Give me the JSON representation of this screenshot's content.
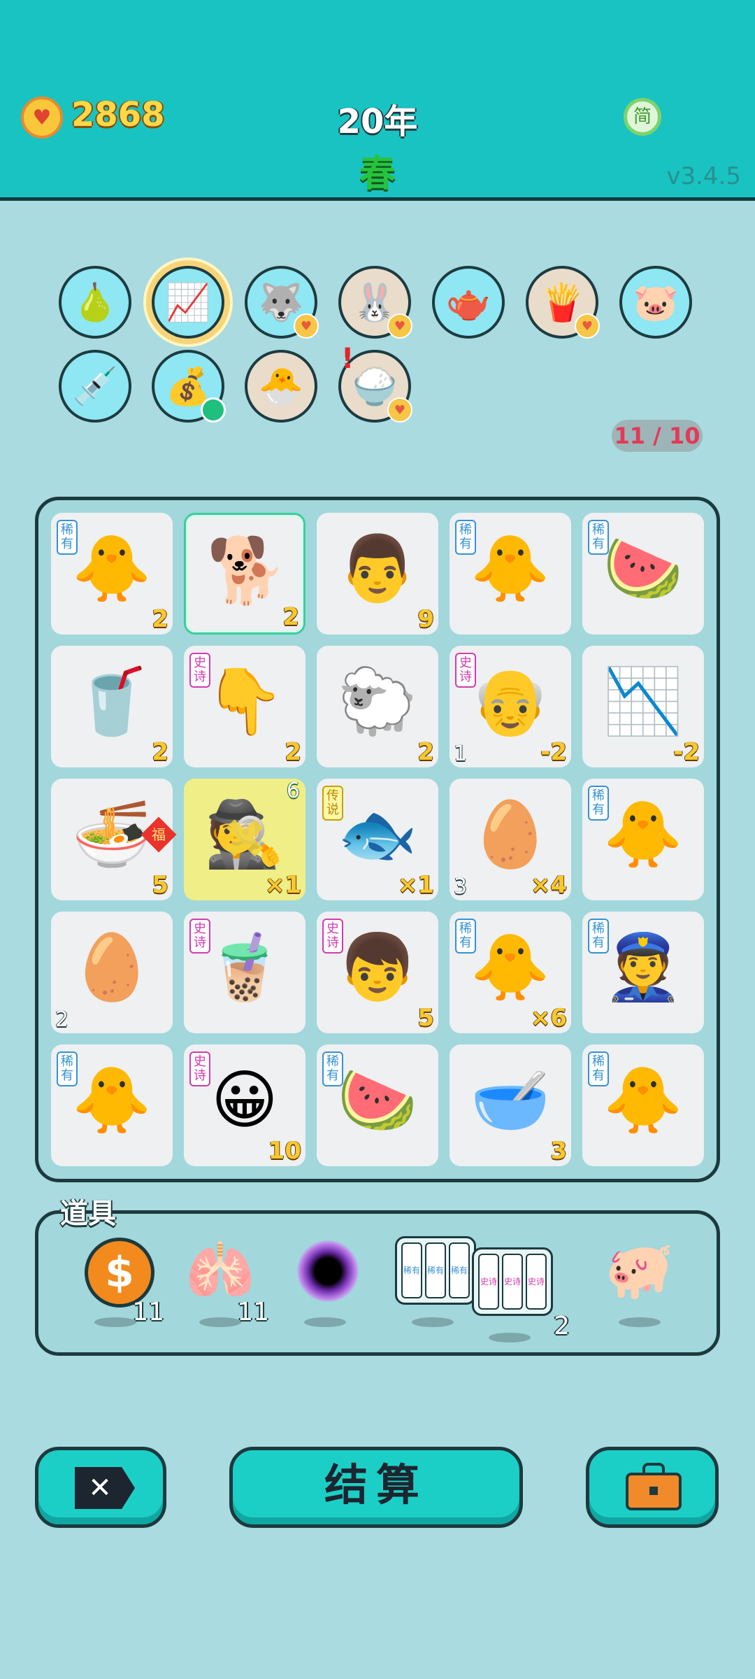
{
  "header": {
    "coins": "2868",
    "year": "20年",
    "season": "春",
    "lang_button": "简",
    "version": "v3.4.5"
  },
  "owned_items": {
    "counter": "11 / 10",
    "items": [
      {
        "icon": "🍐"
      },
      {
        "icon": "📈"
      },
      {
        "icon": "🐺"
      },
      {
        "icon": "🐰"
      },
      {
        "icon": "🫖"
      },
      {
        "icon": "🍟"
      },
      {
        "icon": "🐷"
      },
      {
        "icon": "💉"
      },
      {
        "icon": "💰"
      },
      {
        "icon": "🐣"
      },
      {
        "icon": "🍚"
      }
    ]
  },
  "board": {
    "rows": [
      [
        {
          "icon": "🐥",
          "tag": "稀有",
          "value": "2"
        },
        {
          "icon": "🐕",
          "value": "2"
        },
        {
          "icon": "👨",
          "value": "9"
        },
        {
          "icon": "🐥",
          "tag": "稀有"
        },
        {
          "icon": "🍉",
          "tag": "稀有"
        }
      ],
      [
        {
          "icon": "🥤",
          "value": "2"
        },
        {
          "icon": "👇",
          "tag": "史诗",
          "value": "2"
        },
        {
          "icon": "🐑",
          "value": "2"
        },
        {
          "icon": "👴",
          "tag": "史诗",
          "left": "1",
          "value": "-2"
        },
        {
          "icon": "📉",
          "value": "-2"
        }
      ],
      [
        {
          "icon": "🍜",
          "fu": "福",
          "value": "5"
        },
        {
          "icon": "🕵",
          "top": "6",
          "value": "×1"
        },
        {
          "icon": "🐟",
          "tag": "传说",
          "value": "×1"
        },
        {
          "icon": "🥚",
          "left": "3",
          "value": "×4"
        },
        {
          "icon": "🐥",
          "tag": "稀有"
        }
      ],
      [
        {
          "icon": "🥚",
          "left": "2"
        },
        {
          "icon": "🧋",
          "tag": "史诗"
        },
        {
          "icon": "👦",
          "tag": "史诗",
          "value": "5"
        },
        {
          "icon": "🐥",
          "tag": "稀有",
          "value": "×6"
        },
        {
          "icon": "👮",
          "tag": "稀有"
        }
      ],
      [
        {
          "icon": "🐥",
          "tag": "稀有"
        },
        {
          "icon": "😀",
          "tag": "史诗",
          "value": "10"
        },
        {
          "icon": "🍉",
          "tag": "稀有"
        },
        {
          "icon": "🥣",
          "value": "3"
        },
        {
          "icon": "🐥",
          "tag": "稀有"
        }
      ]
    ]
  },
  "tools": {
    "title": "道具",
    "coin": {
      "symbol": "$",
      "count": "11"
    },
    "liver": {
      "icon": "🫁",
      "count": "11"
    },
    "cards_rare": [
      "稀有",
      "稀有",
      "稀有"
    ],
    "cards_epic": {
      "labels": [
        "史诗",
        "史诗",
        "史诗"
      ],
      "count": "2"
    },
    "piggy": {
      "icon": "🐖"
    }
  },
  "buttons": {
    "close_symbol": "✕",
    "settle": "结算"
  }
}
